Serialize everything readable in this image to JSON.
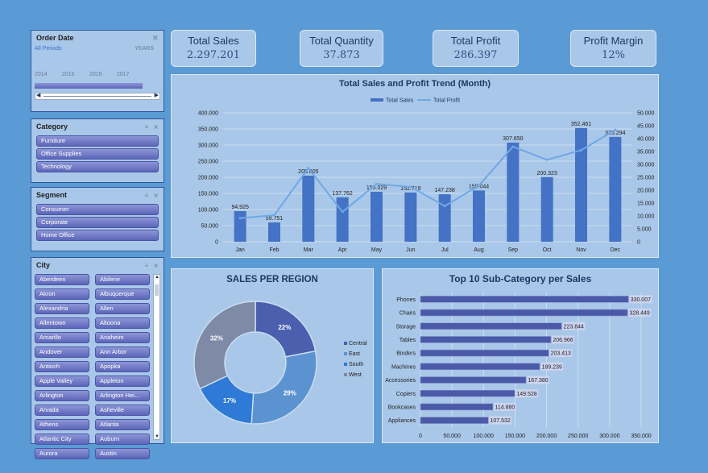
{
  "order_date": {
    "title": "Order Date",
    "all_periods": "All Periods",
    "unit": "YEARS",
    "years": [
      "2014",
      "2015",
      "2016",
      "2017"
    ]
  },
  "category": {
    "title": "Category",
    "items": [
      "Furniture",
      "Office Supplies",
      "Technology"
    ]
  },
  "segment": {
    "title": "Segment",
    "items": [
      "Consumer",
      "Corporate",
      "Home Office"
    ]
  },
  "city": {
    "title": "City",
    "items": [
      "Aberdeen",
      "Abilene",
      "Akron",
      "Albuquerque",
      "Alexandria",
      "Allen",
      "Allentown",
      "Altoona",
      "Amarillo",
      "Anaheim",
      "Andover",
      "Ann Arbor",
      "Antioch",
      "Apopka",
      "Apple Valley",
      "Appleton",
      "Arlington",
      "Arlington Hei...",
      "Arvada",
      "Asheville",
      "Athens",
      "Atlanta",
      "Atlantic City",
      "Auburn",
      "Aurora",
      "Austin"
    ]
  },
  "kpis": [
    {
      "title": "Total Sales",
      "value": "2.297.201"
    },
    {
      "title": "Total Quantity",
      "value": "37.873"
    },
    {
      "title": "Total Profit",
      "value": "286.397"
    },
    {
      "title": "Profit Margin",
      "value": "12%"
    }
  ],
  "chart_data": [
    {
      "type": "bar",
      "title": "Total Sales and Profit Trend (Month)",
      "categories": [
        "Jan",
        "Feb",
        "Mar",
        "Apr",
        "May",
        "Jun",
        "Jul",
        "Aug",
        "Sep",
        "Oct",
        "Nov",
        "Dec"
      ],
      "series": [
        {
          "name": "Total Sales",
          "type": "bar",
          "axis": "left",
          "color": "#4472c4",
          "values": [
            94925,
            59751,
            205005,
            137762,
            155029,
            152719,
            147238,
            159044,
            307650,
            200323,
            352461,
            325294
          ],
          "labels": [
            "94.925",
            "59.751",
            "205.005",
            "137.762",
            "155.029",
            "152.719",
            "147.238",
            "159.044",
            "307.650",
            "200.323",
            "352.461",
            "325.294"
          ]
        },
        {
          "name": "Total Profit",
          "type": "line",
          "axis": "right",
          "color": "#6fa8e6",
          "values": [
            9134,
            10295,
            28594,
            11588,
            22411,
            21285,
            13833,
            21777,
            36857,
            31785,
            35469,
            43369
          ]
        }
      ],
      "y_left": {
        "ylim": [
          0,
          400000
        ],
        "ticks": [
          "0",
          "50.000",
          "100.000",
          "150.000",
          "200.000",
          "250.000",
          "300.000",
          "350.000",
          "400.000"
        ]
      },
      "y_right": {
        "ylim": [
          0,
          50000
        ],
        "ticks": [
          "0",
          "5.000",
          "10.000",
          "15.000",
          "20.000",
          "25.000",
          "30.000",
          "35.000",
          "40.000",
          "45.000",
          "50.000"
        ]
      },
      "legend": "top"
    },
    {
      "type": "pie",
      "title": "SALES PER REGION",
      "categories": [
        "Central",
        "East",
        "South",
        "West"
      ],
      "values": [
        22,
        29,
        17,
        32
      ],
      "labels": [
        "22%",
        "29%",
        "17%",
        "32%"
      ],
      "colors": [
        "#4a5fae",
        "#5b93d1",
        "#2f7ad6",
        "#7f8aa6"
      ],
      "legend": "right"
    },
    {
      "type": "bar",
      "orientation": "horizontal",
      "title": "Top 10 Sub-Category per Sales",
      "categories": [
        "Phones",
        "Chairs",
        "Storage",
        "Tables",
        "Binders",
        "Machines",
        "Accessories",
        "Copiers",
        "Bookcases",
        "Appliances"
      ],
      "values": [
        330007,
        328449,
        223844,
        206966,
        203413,
        189239,
        167380,
        149528,
        114880,
        107532
      ],
      "labels": [
        "330.007",
        "328.449",
        "223.844",
        "206.966",
        "203.413",
        "189.239",
        "167.380",
        "149.528",
        "114.880",
        "107.532"
      ],
      "xlim": [
        0,
        350000
      ],
      "ticks": [
        "0",
        "50.000",
        "100.000",
        "150.000",
        "200.000",
        "250.000",
        "300.000",
        "350.000"
      ],
      "color": "#4a5aa8"
    }
  ]
}
